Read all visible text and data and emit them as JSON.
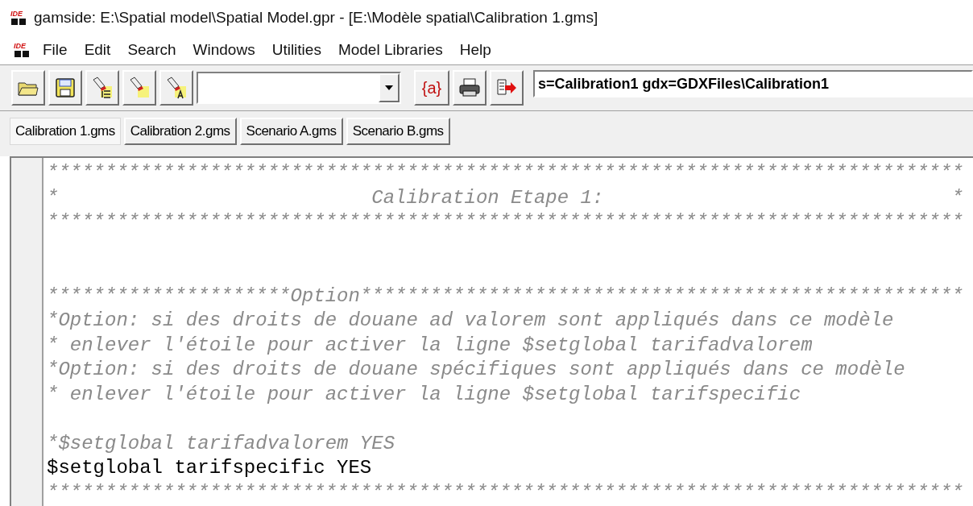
{
  "window": {
    "logo": "IDE",
    "title": "gamside: E:\\Spatial model\\Spatial Model.gpr - [E:\\Modèle spatial\\Calibration 1.gms]"
  },
  "menu_logo": "IDE",
  "menu": [
    "File",
    "Edit",
    "Search",
    "Windows",
    "Utilities",
    "Model Libraries",
    "Help"
  ],
  "toolbar": {
    "tools": [
      {
        "kind": "open"
      },
      {
        "kind": "save"
      },
      {
        "kind": "find-tree"
      },
      {
        "kind": "find"
      },
      {
        "kind": "find-a"
      },
      {
        "kind": "combo"
      },
      {
        "kind": "text",
        "label": "{a}"
      },
      {
        "kind": "print"
      },
      {
        "kind": "run"
      }
    ],
    "command": "s=Calibration1 gdx=GDXFiles\\Calibration1"
  },
  "tabs": [
    {
      "label": "Calibration 1.gms",
      "selected": true
    },
    {
      "label": "Calibration 2.gms",
      "selected": false
    },
    {
      "label": "Scenario A.gms",
      "selected": false
    },
    {
      "label": "Scenario B.gms",
      "selected": false
    }
  ],
  "editor": {
    "lines": [
      {
        "kind": "comment",
        "text": "*******************************************************************************"
      },
      {
        "kind": "comment",
        "text": "*                           Calibration Etape 1:                              *"
      },
      {
        "kind": "comment",
        "text": "*******************************************************************************"
      },
      {
        "kind": "blank"
      },
      {
        "kind": "blank"
      },
      {
        "kind": "comment",
        "text": "*********************Option****************************************************"
      },
      {
        "kind": "comment",
        "text": "*Option: si des droits de douane ad valorem sont appliqués dans ce modèle"
      },
      {
        "kind": "comment",
        "text": "* enlever l'étoile pour activer la ligne $setglobal tarifadvalorem"
      },
      {
        "kind": "comment",
        "text": "*Option: si des droits de douane spécifiques sont appliqués dans ce modèle"
      },
      {
        "kind": "comment",
        "text": "* enlever l'étoile pour activer la ligne $setglobal tarifspecific"
      },
      {
        "kind": "blank"
      },
      {
        "kind": "comment",
        "text": "*$setglobal tarifadvalorem YES"
      },
      {
        "kind": "code",
        "text": "$setglobal tarifspecific YES"
      },
      {
        "kind": "comment",
        "text": "*******************************************************************************"
      }
    ]
  }
}
